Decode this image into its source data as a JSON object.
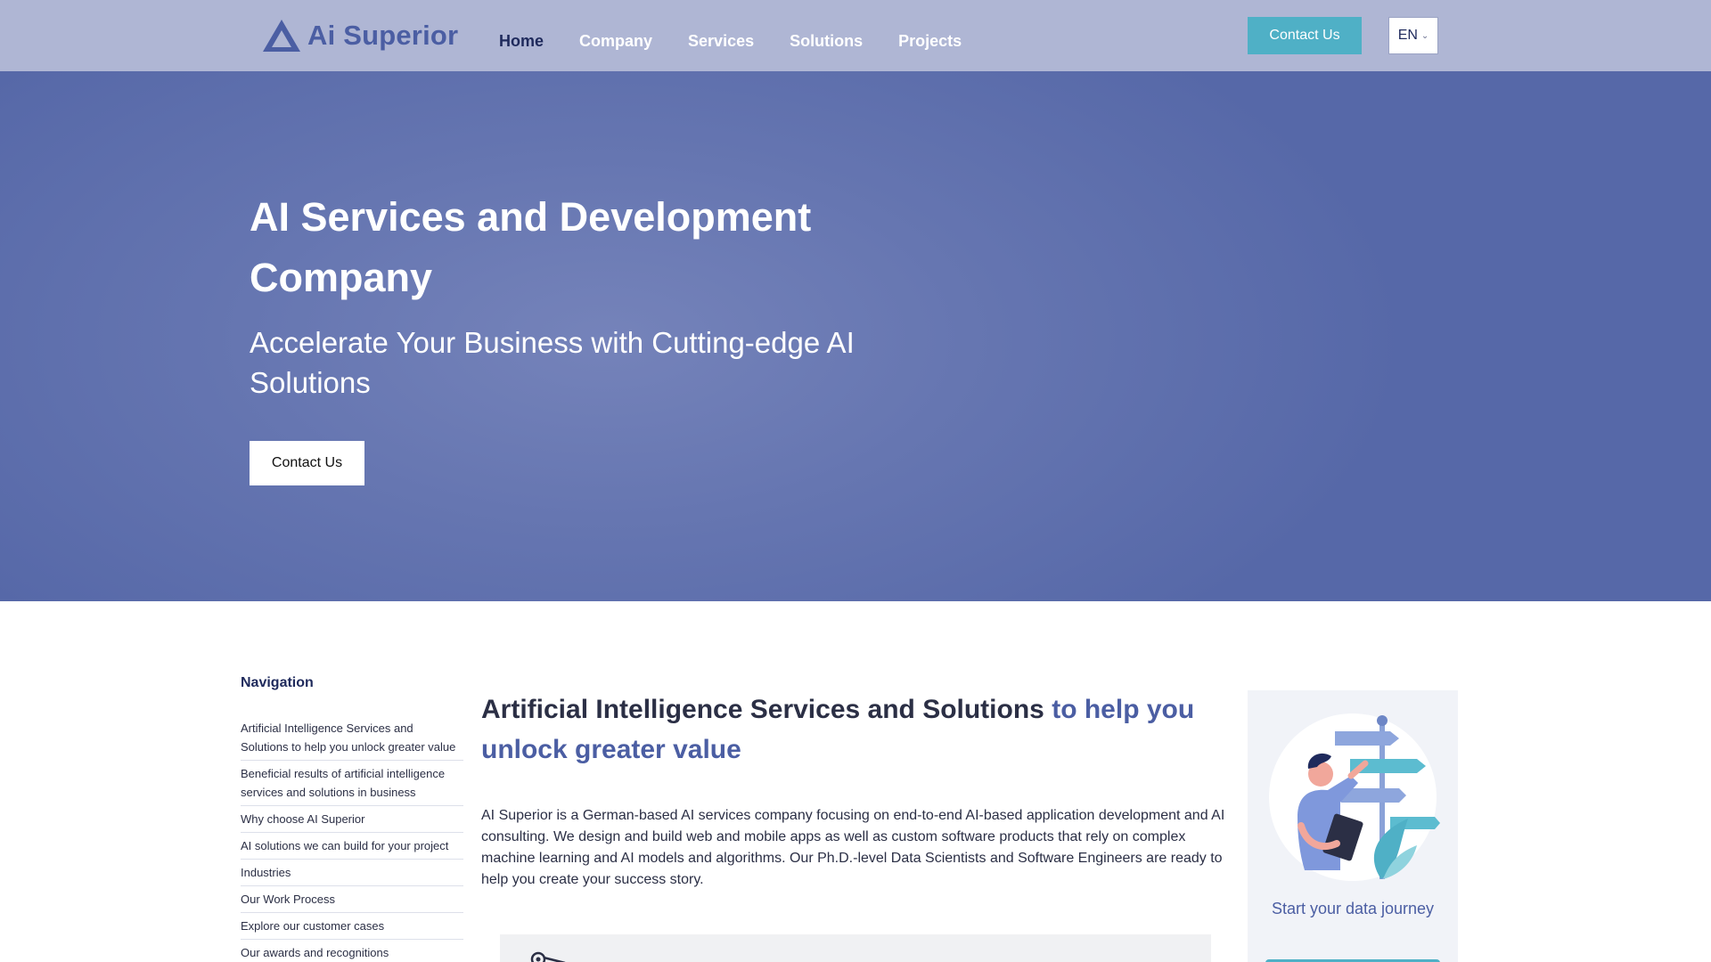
{
  "header": {
    "logo_text": "Ai Superior",
    "nav": [
      "Home",
      "Company",
      "Services",
      "Solutions",
      "Projects"
    ],
    "contact_label": "Contact Us",
    "language": "EN",
    "colors": {
      "background": "#afb6d4",
      "active_nav": "#1f2a5c",
      "contact_button": "#4fb0c6"
    }
  },
  "hero": {
    "title": "AI Services and Development Company",
    "subtitle": "Accelerate Your Business with Cutting-edge AI Solutions",
    "cta_label": "Contact Us",
    "color": "#6676b1"
  },
  "sidebar": {
    "title": "Navigation",
    "items": [
      "Artificial Intelligence Services and Solutions to help you unlock greater value",
      "Beneficial results of artificial intelligence services and solutions in business",
      "Why choose AI Superior",
      "AI solutions we can build for your project",
      "Industries",
      "Our Work Process",
      "Explore our customer cases",
      "Our awards and recognitions"
    ]
  },
  "main": {
    "title_part1": "Artificial Intelligence Services and Solutions",
    "title_part2": "to help you unlock greater value",
    "intro": "AI Superior is a German-based AI services company focusing on end-to-end AI-based application development and AI consulting. We design and build web and mobile apps as well as custom software products that rely on complex machine learning and AI models and algorithms. Our Ph.D.-level Data Scientists and Software Engineers are ready to help you create your success story."
  },
  "promo": {
    "text": "Start your data journey",
    "icons": [
      "signpost-illustration"
    ]
  }
}
